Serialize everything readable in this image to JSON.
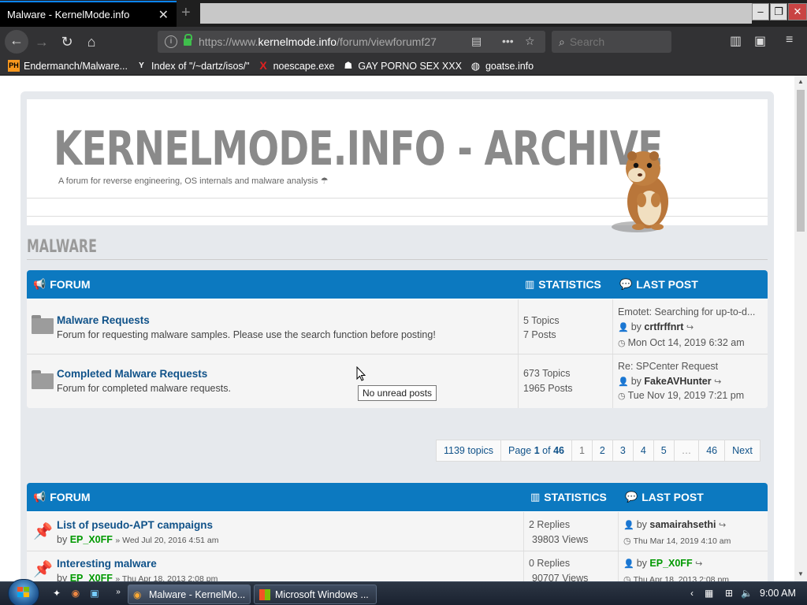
{
  "browser": {
    "tab_title": "Malware - KernelMode.info",
    "url_prefix": "https://www.",
    "url_domain": "kernelmode.info",
    "url_path": "/forum/viewforumf27",
    "search_placeholder": "Search",
    "bookmarks": [
      {
        "icon": "PH",
        "label": "Endermanch/Malware..."
      },
      {
        "icon": "Y",
        "label": "Index of \"/~dartz/isos/\""
      },
      {
        "icon": "X",
        "label": "noescape.exe"
      },
      {
        "icon": "ghost",
        "label": "GAY PORNO SEX XXX"
      },
      {
        "icon": "globe",
        "label": "goatse.info"
      }
    ]
  },
  "header": {
    "site_title": "KERNELMODE.INFO - ARCHIVE",
    "tagline": "A forum for reverse engineering, OS internals and malware analysis"
  },
  "forum": {
    "title": "MALWARE",
    "columns": {
      "forum": "FORUM",
      "statistics": "STATISTICS",
      "last_post": "LAST POST"
    },
    "subforums": [
      {
        "title": "Malware Requests",
        "description": "Forum for requesting malware samples. Please use the search function before posting!",
        "topics": "5 Topics",
        "posts": "7 Posts",
        "last_title": "Emotet: Searching for up-to-d...",
        "last_by_prefix": "by",
        "last_by": "crtfrffnrt",
        "last_date": "Mon Oct 14, 2019 6:32 am"
      },
      {
        "title": "Completed Malware Requests",
        "description": "Forum for completed malware requests.",
        "topics": "673 Topics",
        "posts": "1965 Posts",
        "last_title": "Re: SPCenter Request",
        "last_by_prefix": "by",
        "last_by": "FakeAVHunter",
        "last_date": "Tue Nov 19, 2019 7:21 pm"
      }
    ],
    "tooltip": "No unread posts"
  },
  "pagination": {
    "topics_count": "1139 topics",
    "page_label_prefix": "Page",
    "page_current": "1",
    "page_of": "of",
    "page_total": "46",
    "pages": [
      "1",
      "2",
      "3",
      "4",
      "5",
      "…",
      "46"
    ],
    "next": "Next"
  },
  "topics_block": {
    "columns": {
      "forum": "FORUM",
      "statistics": "STATISTICS",
      "last_post": "LAST POST"
    },
    "topics": [
      {
        "title": "List of pseudo-APT campaigns",
        "by_prefix": "by",
        "author": "EP_X0FF",
        "date": "» Wed Jul 20, 2016 4:51 am",
        "replies": "2 Replies",
        "views": "39803 Views",
        "last_by": "samairahsethi",
        "last_date": "Thu Mar 14, 2019 4:10 am"
      },
      {
        "title": "Interesting malware",
        "by_prefix": "by",
        "author": "EP_X0FF",
        "date": "» Thu Apr 18, 2013 2:08 pm",
        "replies": "0 Replies",
        "views": "90707 Views",
        "last_by": "EP_X0FF",
        "last_date": "Thu Apr 18, 2013 2:08 pm"
      }
    ]
  },
  "taskbar": {
    "tasks": [
      "Malware - KernelMo...",
      "Microsoft Windows ..."
    ],
    "clock": "9:00 AM"
  },
  "colors": {
    "accent": "#0c79c0",
    "link": "#105289",
    "green_user": "#009900"
  }
}
